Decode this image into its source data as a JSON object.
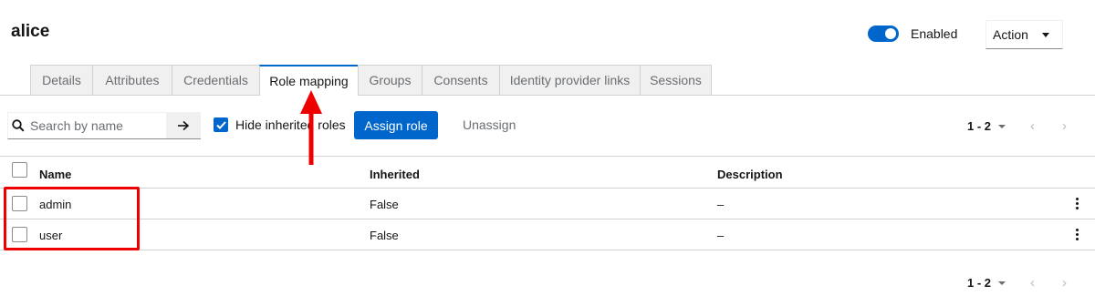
{
  "header": {
    "title": "alice",
    "enabled_label": "Enabled",
    "enabled": true,
    "action_label": "Action"
  },
  "tabs": [
    {
      "label": "Details",
      "active": false
    },
    {
      "label": "Attributes",
      "active": false
    },
    {
      "label": "Credentials",
      "active": false
    },
    {
      "label": "Role mapping",
      "active": true
    },
    {
      "label": "Groups",
      "active": false
    },
    {
      "label": "Consents",
      "active": false
    },
    {
      "label": "Identity provider links",
      "active": false
    },
    {
      "label": "Sessions",
      "active": false
    }
  ],
  "toolbar": {
    "search_placeholder": "Search by name",
    "hide_inherited_label": "Hide inherited roles",
    "hide_inherited_checked": true,
    "assign_label": "Assign role",
    "unassign_label": "Unassign",
    "pagination_range": "1 - 2",
    "prev_icon": "chevron-left-icon",
    "next_icon": "chevron-right-icon"
  },
  "table": {
    "columns": [
      "Name",
      "Inherited",
      "Description"
    ],
    "rows": [
      {
        "name": "admin",
        "inherited": "False",
        "description": "–"
      },
      {
        "name": "user",
        "inherited": "False",
        "description": "–"
      }
    ]
  },
  "footer": {
    "pagination_range": "1 - 2"
  },
  "colors": {
    "primary": "#0066cc",
    "annotation": "#ee0000"
  }
}
